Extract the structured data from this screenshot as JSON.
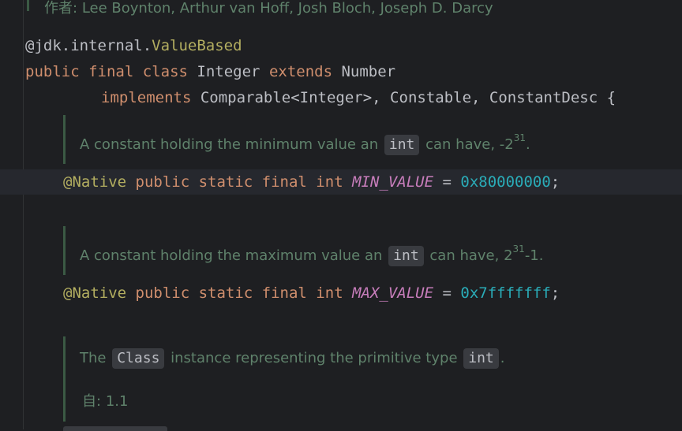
{
  "top_doc": {
    "label": "作者:",
    "authors": "Lee Boynton, Arthur van Hoff, Josh Bloch, Joseph D. Darcy"
  },
  "annotation_line": {
    "at": "@jdk.internal.",
    "name": "ValueBased"
  },
  "class_decl": {
    "kw_public": "public",
    "kw_final": "final",
    "kw_class": "class",
    "class_name": "Integer",
    "kw_extends": "extends",
    "parent": "Number",
    "kw_implements": "implements",
    "interfaces": "Comparable<Integer>, Constable, ConstantDesc {"
  },
  "min_doc": {
    "before": "A constant holding the minimum value an",
    "code": "int",
    "after": "can have, -2",
    "sup": "31",
    "end": "."
  },
  "min_field": {
    "annotation": "@Native",
    "mods": "public static final int",
    "name": "MIN_VALUE",
    "eq": " = ",
    "value": "0x80000000",
    "semi": ";"
  },
  "max_doc": {
    "before": "A constant holding the maximum value an",
    "code": "int",
    "after": "can have, 2",
    "sup": "31",
    "end": "-1."
  },
  "max_field": {
    "annotation": "@Native",
    "mods": "public static final int",
    "name": "MAX_VALUE",
    "eq": " = ",
    "value": "0x7fffffff",
    "semi": ";"
  },
  "type_doc": {
    "the": "The",
    "code1": "Class",
    "middle": "instance representing the primitive type",
    "code2": "int",
    "end": "."
  },
  "since": {
    "label": "自:",
    "value": "1.1"
  },
  "colors": {
    "background": "#1e1f22",
    "keyword": "#cf8e6d",
    "annotation": "#b3ae60",
    "number": "#2aacb8",
    "constant": "#c77dbb",
    "doc_text": "#5f826b"
  }
}
